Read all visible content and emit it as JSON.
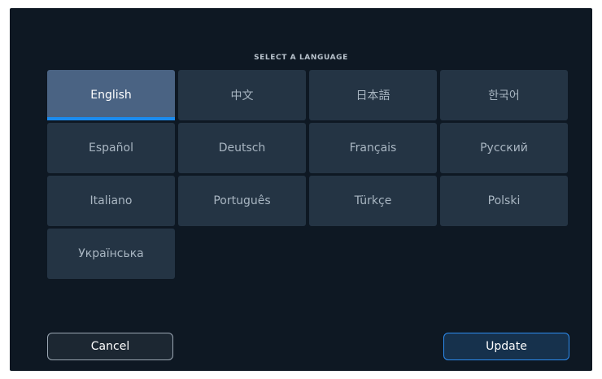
{
  "dialog": {
    "title": "SELECT A LANGUAGE",
    "selected_language": "English",
    "languages": [
      {
        "label": "English"
      },
      {
        "label": "中文"
      },
      {
        "label": "日本語"
      },
      {
        "label": "한국어"
      },
      {
        "label": "Español"
      },
      {
        "label": "Deutsch"
      },
      {
        "label": "Français"
      },
      {
        "label": "Русский"
      },
      {
        "label": "Italiano"
      },
      {
        "label": "Português"
      },
      {
        "label": "Türkçe"
      },
      {
        "label": "Polski"
      },
      {
        "label": "Українська"
      }
    ],
    "cancel_label": "Cancel",
    "update_label": "Update"
  },
  "colors": {
    "background": "#0e1823",
    "tile": "#243444",
    "tile_selected": "#4a6383",
    "accent": "#1a8cf0"
  }
}
